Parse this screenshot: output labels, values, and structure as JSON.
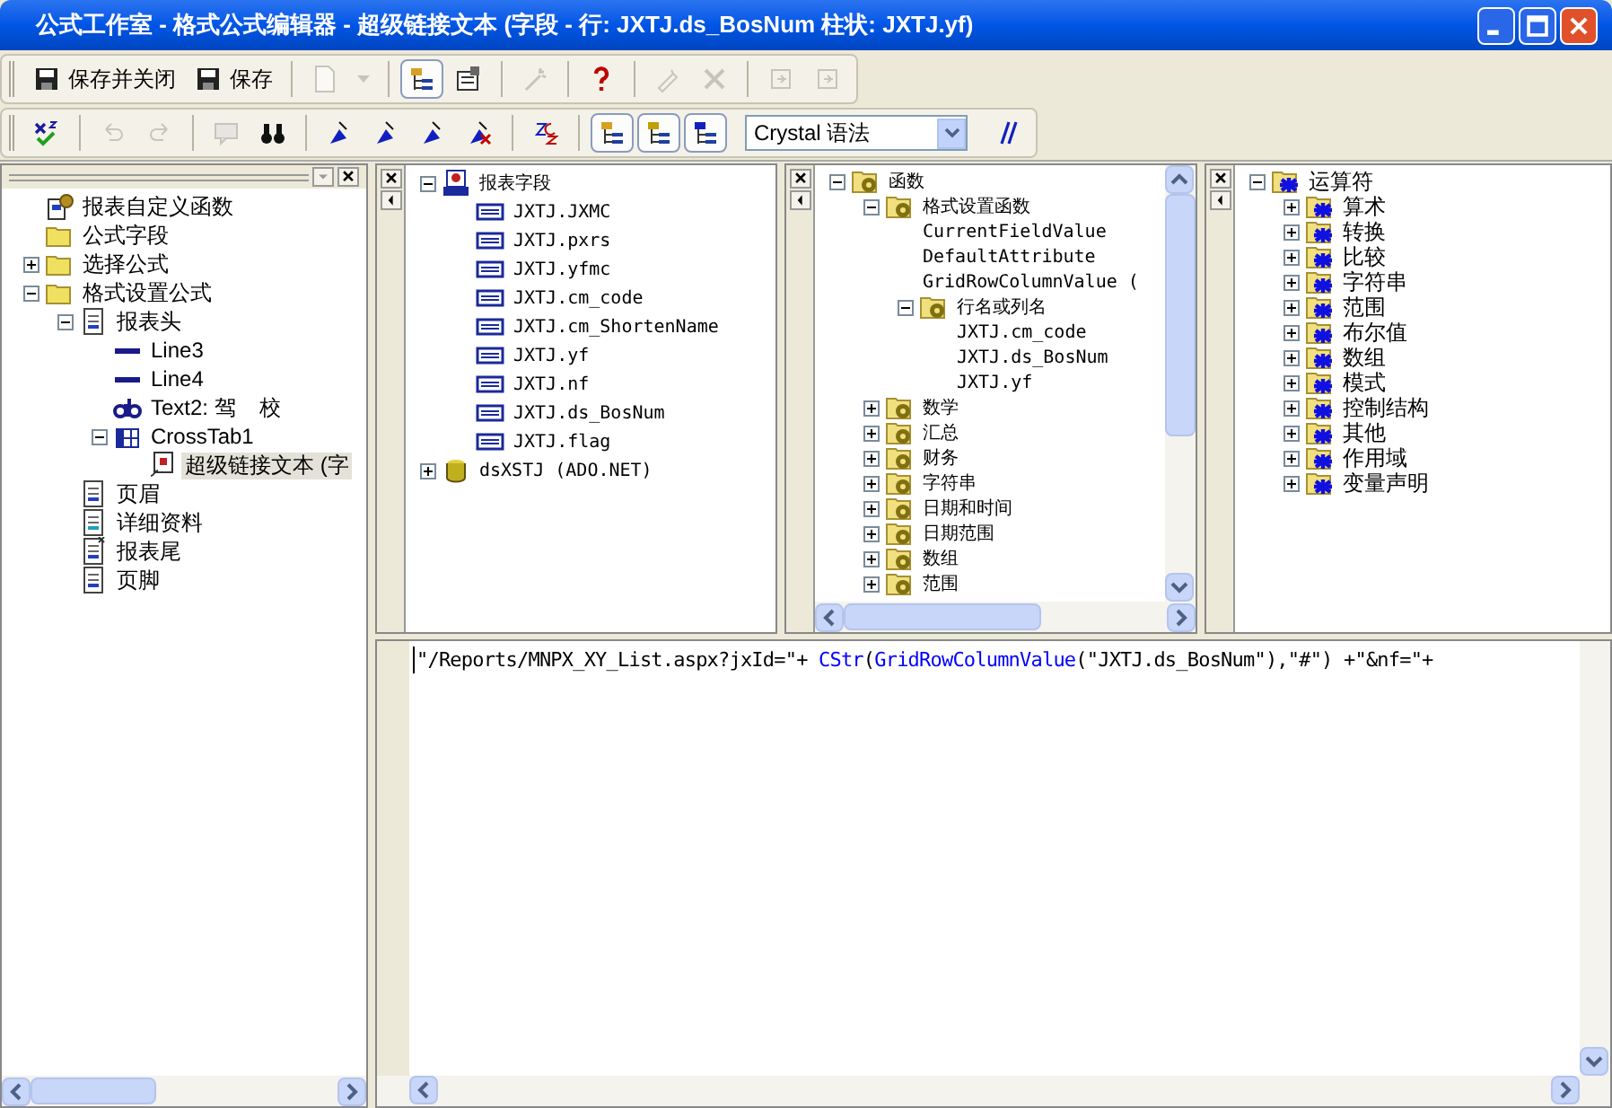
{
  "window": {
    "title": "公式工作室 - 格式公式编辑器 - 超级链接文本 (字段 - 行: JXTJ.ds_BosNum 柱状: JXTJ.yf)"
  },
  "toolbar_1": [
    {
      "kind": "button",
      "label": "保存并关闭",
      "disabled": false,
      "pressed": false
    },
    {
      "kind": "button",
      "label": "保存",
      "disabled": false,
      "pressed": false
    },
    {
      "kind": "separator"
    },
    {
      "kind": "button",
      "disabled": true,
      "pressed": false
    },
    {
      "kind": "button",
      "disabled": true,
      "pressed": false
    },
    {
      "kind": "separator"
    },
    {
      "kind": "button",
      "disabled": false,
      "pressed": true
    },
    {
      "kind": "button",
      "disabled": false,
      "pressed": false
    },
    {
      "kind": "separator"
    },
    {
      "kind": "button",
      "disabled": true,
      "pressed": false
    },
    {
      "kind": "separator"
    },
    {
      "kind": "button",
      "disabled": false,
      "pressed": false
    },
    {
      "kind": "separator"
    },
    {
      "kind": "button",
      "disabled": true,
      "pressed": false
    },
    {
      "kind": "button",
      "disabled": true,
      "pressed": false
    },
    {
      "kind": "separator"
    },
    {
      "kind": "button",
      "disabled": true,
      "pressed": false
    },
    {
      "kind": "button",
      "disabled": true,
      "pressed": false
    }
  ],
  "toolbar_2": [
    {
      "kind": "button",
      "disabled": false,
      "pressed": false
    },
    {
      "kind": "separator"
    },
    {
      "kind": "button",
      "disabled": true,
      "pressed": false
    },
    {
      "kind": "button",
      "disabled": true,
      "pressed": false
    },
    {
      "kind": "separator"
    },
    {
      "kind": "button",
      "disabled": true,
      "pressed": false
    },
    {
      "kind": "button",
      "disabled": false,
      "pressed": false
    },
    {
      "kind": "separator"
    },
    {
      "kind": "button",
      "disabled": false,
      "pressed": false
    },
    {
      "kind": "button",
      "disabled": false,
      "pressed": false
    },
    {
      "kind": "button",
      "disabled": false,
      "pressed": false
    },
    {
      "kind": "button",
      "disabled": false,
      "pressed": false
    },
    {
      "kind": "separator"
    },
    {
      "kind": "button",
      "disabled": false,
      "pressed": false
    },
    {
      "kind": "separator"
    },
    {
      "kind": "button",
      "disabled": false,
      "pressed": true
    },
    {
      "kind": "button",
      "disabled": false,
      "pressed": true
    },
    {
      "kind": "button",
      "disabled": false,
      "pressed": true
    },
    {
      "kind": "select",
      "value": "Crystal 语法"
    },
    {
      "kind": "button",
      "disabled": false,
      "pressed": false
    }
  ],
  "formula_tree": [
    {
      "kind": "functions",
      "label": "报表自定义函数"
    },
    {
      "kind": "folder",
      "label": "公式字段"
    },
    {
      "kind": "folder",
      "label": "选择公式",
      "expanded": false
    },
    {
      "kind": "folder",
      "label": "格式设置公式",
      "expanded": true,
      "children": [
        {
          "kind": "section",
          "label": "报表头",
          "expanded": true,
          "children": [
            {
              "kind": "line",
              "label": "Line3"
            },
            {
              "kind": "line",
              "label": "Line4"
            },
            {
              "kind": "text",
              "label": "Text2: 驾    校"
            },
            {
              "kind": "crosstab",
              "label": "CrossTab1",
              "expanded": true,
              "children": [
                {
                  "kind": "hyperlink",
                  "label": "超级链接文本 (字",
                  "selected": true
                }
              ]
            }
          ]
        },
        {
          "kind": "section",
          "label": "页眉"
        },
        {
          "kind": "detail",
          "label": "详细资料"
        },
        {
          "kind": "footer",
          "label": "报表尾"
        },
        {
          "kind": "section",
          "label": "页脚"
        }
      ]
    }
  ],
  "field_tree": [
    {
      "kind": "report",
      "label": "报表字段",
      "expanded": true,
      "children": [
        {
          "kind": "field",
          "label": "JXTJ.JXMC"
        },
        {
          "kind": "field",
          "label": "JXTJ.pxrs"
        },
        {
          "kind": "field",
          "label": "JXTJ.yfmc"
        },
        {
          "kind": "field",
          "label": "JXTJ.cm_code"
        },
        {
          "kind": "field",
          "label": "JXTJ.cm_ShortenName"
        },
        {
          "kind": "field",
          "label": "JXTJ.yf"
        },
        {
          "kind": "field",
          "label": "JXTJ.nf"
        },
        {
          "kind": "field",
          "label": "JXTJ.ds_BosNum"
        },
        {
          "kind": "field",
          "label": "JXTJ.flag"
        }
      ]
    },
    {
      "kind": "database",
      "label": "dsXSTJ (ADO.NET)",
      "expanded": false
    }
  ],
  "function_tree": [
    {
      "kind": "category",
      "label": "函数",
      "expanded": true,
      "children": [
        {
          "kind": "category",
          "label": "格式设置函数",
          "expanded": true,
          "children": [
            {
              "label": "CurrentFieldValue"
            },
            {
              "label": "DefaultAttribute"
            },
            {
              "label": "GridRowColumnValue ("
            },
            {
              "kind": "category",
              "label": "行名或列名",
              "expanded": true,
              "children": [
                {
                  "label": "JXTJ.cm_code"
                },
                {
                  "label": "JXTJ.ds_BosNum"
                },
                {
                  "label": "JXTJ.yf"
                }
              ]
            }
          ]
        },
        {
          "kind": "category",
          "label": "数学",
          "expanded": false
        },
        {
          "kind": "category",
          "label": "汇总",
          "expanded": false
        },
        {
          "kind": "category",
          "label": "财务",
          "expanded": false
        },
        {
          "kind": "category",
          "label": "字符串",
          "expanded": false
        },
        {
          "kind": "category",
          "label": "日期和时间",
          "expanded": false
        },
        {
          "kind": "category",
          "label": "日期范围",
          "expanded": false
        },
        {
          "kind": "category",
          "label": "数组",
          "expanded": false
        },
        {
          "kind": "category",
          "label": "范围",
          "expanded": false
        }
      ]
    }
  ],
  "operator_tree": [
    {
      "kind": "operators",
      "label": "运算符",
      "expanded": true,
      "children": [
        {
          "kind": "operators",
          "label": "算术",
          "expanded": false
        },
        {
          "kind": "operators",
          "label": "转换",
          "expanded": false
        },
        {
          "kind": "operators",
          "label": "比较",
          "expanded": false
        },
        {
          "kind": "operators",
          "label": "字符串",
          "expanded": false
        },
        {
          "kind": "operators",
          "label": "范围",
          "expanded": false
        },
        {
          "kind": "operators",
          "label": "布尔值",
          "expanded": false
        },
        {
          "kind": "operators",
          "label": "数组",
          "expanded": false
        },
        {
          "kind": "operators",
          "label": "模式",
          "expanded": false
        },
        {
          "kind": "operators",
          "label": "控制结构",
          "expanded": false
        },
        {
          "kind": "operators",
          "label": "其他",
          "expanded": false
        },
        {
          "kind": "operators",
          "label": "作用域",
          "expanded": false
        },
        {
          "kind": "operators",
          "label": "变量声明",
          "expanded": false
        }
      ]
    }
  ],
  "editor": {
    "code": [
      {
        "kind": "plain",
        "text": "\"/Reports/MNPX_XY_List.aspx?jxId=\"+ "
      },
      {
        "kind": "keyword",
        "text": "CStr"
      },
      {
        "kind": "plain",
        "text": "("
      },
      {
        "kind": "keyword",
        "text": "GridRowColumnValue"
      },
      {
        "kind": "plain",
        "text": "(\"JXTJ.ds_BosNum\"),\"#\") +\"&nf=\"+ "
      }
    ]
  }
}
